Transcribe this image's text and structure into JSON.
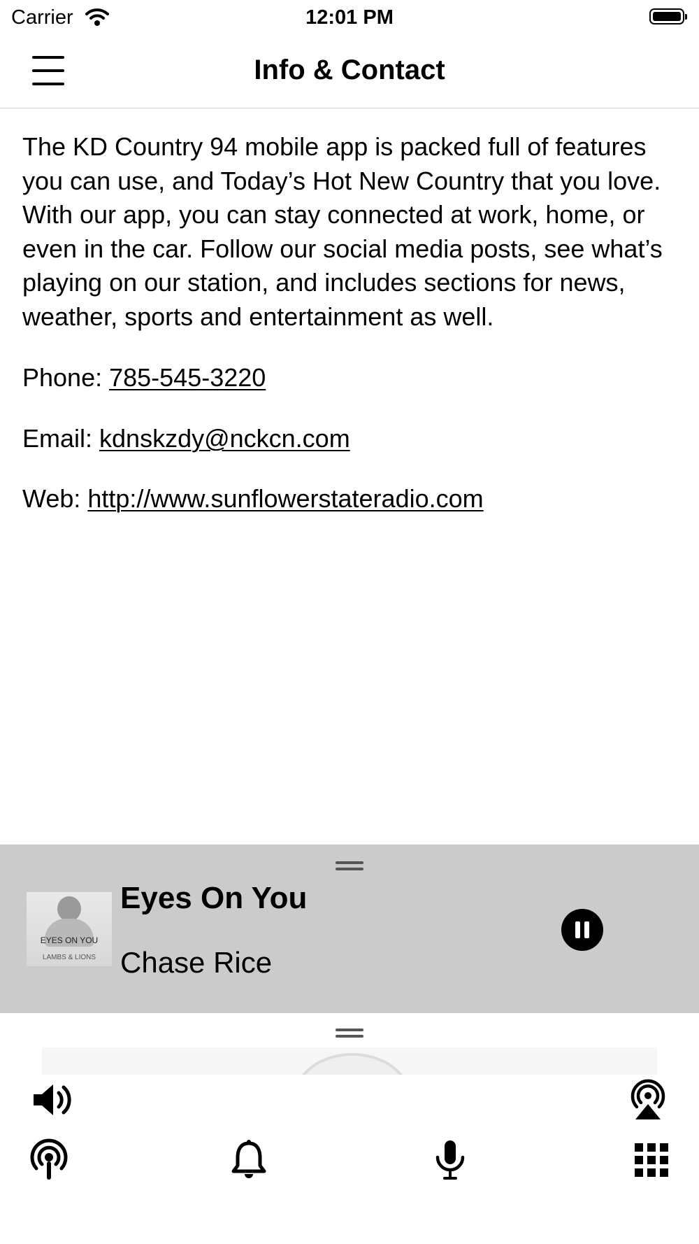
{
  "status_bar": {
    "carrier": "Carrier",
    "time": "12:01 PM",
    "icons": [
      "wifi-icon",
      "battery-icon"
    ]
  },
  "nav": {
    "title": "Info & Contact",
    "menu_icon": "hamburger-menu-icon"
  },
  "content": {
    "description": "The KD Country 94 mobile app is packed full of features you can use, and Today’s Hot New Country that you love. With our app, you can stay connected at work, home, or even in the car. Follow our social media posts, see what’s playing on our station, and includes sections for news, weather, sports and entertainment as well.",
    "phone_label": "Phone: ",
    "phone": "785-545-3220",
    "email_label": "Email: ",
    "email": "kdnskzdy@nckcn.com",
    "web_label": "Web: ",
    "web": "http://www.sunflowerstateradio.com"
  },
  "player": {
    "song": "Eyes On You",
    "artist": "Chase Rice",
    "artwork_text_title": "EYES ON YOU",
    "artwork_text_album": "LAMBS & LIONS",
    "state": "playing",
    "pause_icon": "pause-icon"
  },
  "controls": {
    "top_row": [
      "volume-icon",
      "airplay-icon"
    ],
    "bottom_row": [
      "radio-stream-icon",
      "bell-icon",
      "microphone-icon",
      "grid-menu-icon"
    ]
  },
  "colors": {
    "background": "#ffffff",
    "player_background": "#cbcbcb",
    "text": "#000000"
  }
}
